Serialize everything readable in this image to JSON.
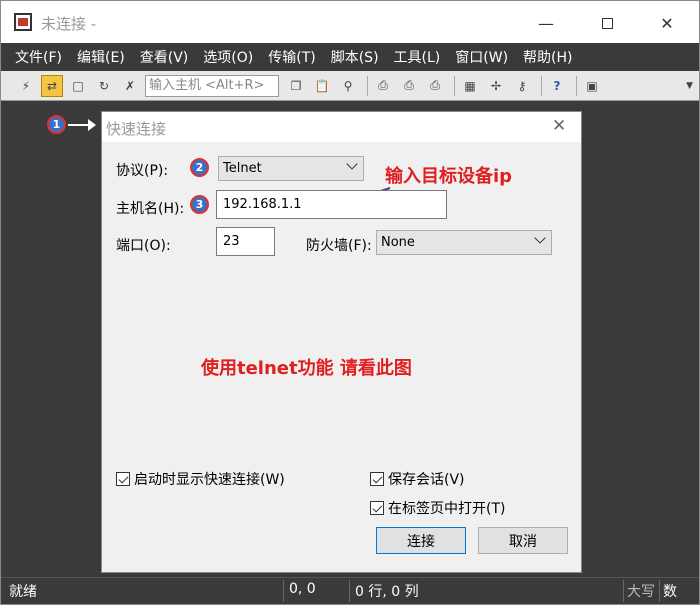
{
  "window": {
    "title": "未连接 -"
  },
  "menu": [
    "文件(F)",
    "编辑(E)",
    "查看(V)",
    "选项(O)",
    "传输(T)",
    "脚本(S)",
    "工具(L)",
    "窗口(W)",
    "帮助(H)"
  ],
  "toolbar": {
    "host_placeholder": "输入主机 <Alt+R>"
  },
  "status": {
    "ready": "就绪",
    "cursor": "0, 0",
    "position": "0 行, 0 列",
    "caps": "大写",
    "num": "数"
  },
  "markers": [
    "1",
    "2",
    "3"
  ],
  "dialog": {
    "title": "快速连接",
    "protocol_label": "协议(P):",
    "protocol_value": "Telnet",
    "host_label": "主机名(H):",
    "host_value": "192.168.1.1",
    "port_label": "端口(O):",
    "port_value": "23",
    "firewall_label": "防火墙(F):",
    "firewall_value": "None",
    "chk_startup": "启动时显示快速连接(W)",
    "chk_save": "保存会话(V)",
    "chk_tab": "在标签页中打开(T)",
    "connect_btn": "连接",
    "cancel_btn": "取消"
  },
  "annotations": {
    "target_ip": "输入目标设备ip",
    "telnet_hint": "使用telnet功能 请看此图"
  },
  "colors": {
    "annotation": "#e02020",
    "marker_fill": "#3a6fc4",
    "marker_ring": "#e03030",
    "dark_bg": "#3a3a3a"
  }
}
